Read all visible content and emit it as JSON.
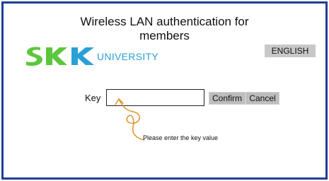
{
  "header": {
    "title_line1": "Wireless LAN authentication for",
    "title_line2": "members"
  },
  "brand": {
    "logo_text": "SKK",
    "logo_colors": {
      "s": "#5cc63c",
      "k1": "#5cc63c",
      "k2": "#2aa0d6"
    },
    "university_label": "UNIVERSITY"
  },
  "language": {
    "label": "ENGLISH"
  },
  "form": {
    "key_label": "Key",
    "key_value": "",
    "confirm_label": "Confirm",
    "cancel_label": "Cancel"
  },
  "hint": {
    "text": "Please enter the key value",
    "arrow_color": "#e0912a"
  },
  "colors": {
    "frame_border": "#1f3e95",
    "button_bg": "#c8c8c8"
  }
}
